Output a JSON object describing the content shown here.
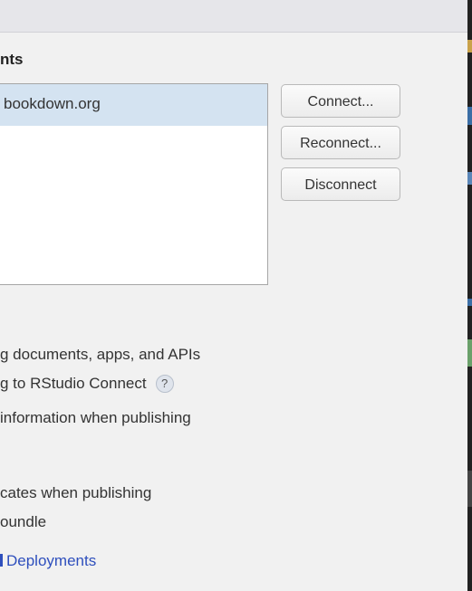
{
  "section": {
    "title": "nts"
  },
  "accounts": {
    "items": [
      "bookdown.org"
    ]
  },
  "buttons": {
    "connect": "Connect...",
    "reconnect": "Reconnect...",
    "disconnect": "Disconnect"
  },
  "options": {
    "line1": "g documents, apps, and APIs",
    "line2": "g to RStudio Connect",
    "help_glyph": "?",
    "line3": " information when publishing",
    "line4": "cates when publishing",
    "line5": "oundle"
  },
  "link": {
    "label": "Deployments"
  }
}
